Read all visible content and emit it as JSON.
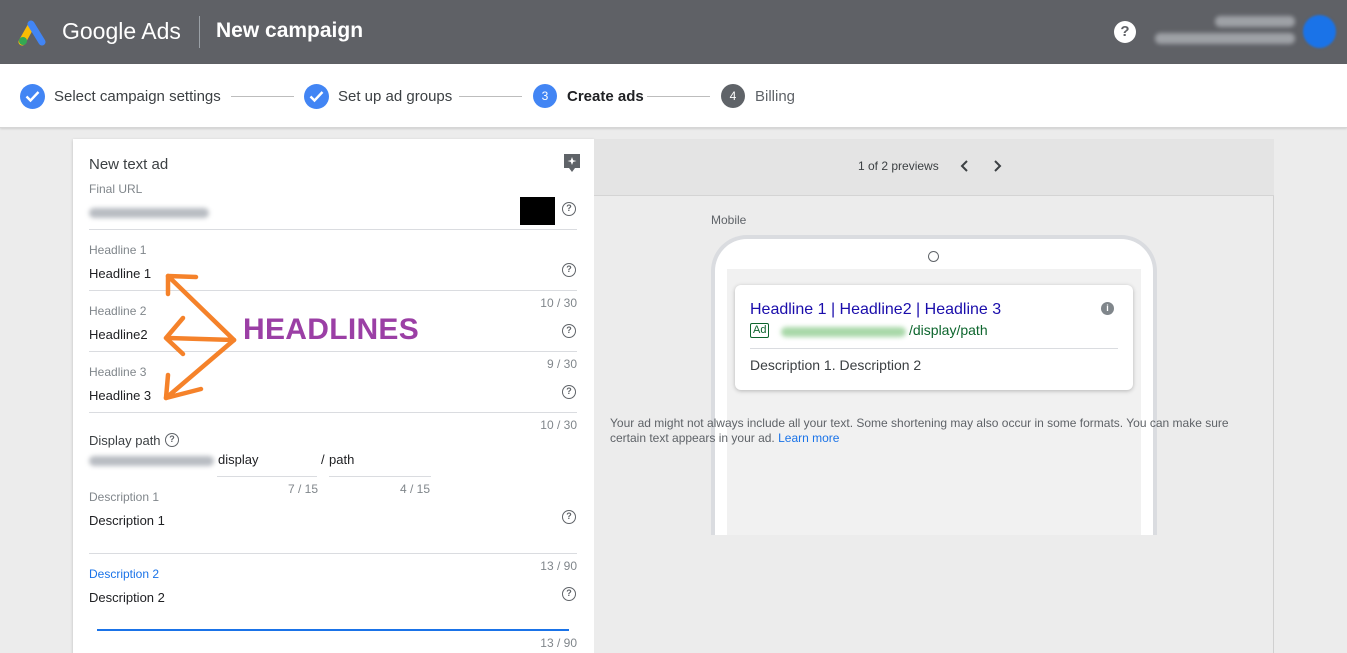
{
  "header": {
    "brand": "Google Ads",
    "page_title": "New campaign",
    "help_icon": "help-circle-icon",
    "help_glyph": "?"
  },
  "stepper": {
    "steps": [
      {
        "number": "",
        "label": "Select campaign settings",
        "state": "done"
      },
      {
        "number": "",
        "label": "Set up ad groups",
        "state": "done"
      },
      {
        "number": "3",
        "label": "Create ads",
        "state": "current"
      },
      {
        "number": "4",
        "label": "Billing",
        "state": "upcoming"
      }
    ]
  },
  "ad_form": {
    "title": "New text ad",
    "final_url": {
      "label": "Final URL"
    },
    "headline1": {
      "label": "Headline 1",
      "value": "Headline 1",
      "counter": "10 / 30"
    },
    "headline2": {
      "label": "Headline 2",
      "value": "Headline2",
      "counter": "9 / 30"
    },
    "headline3": {
      "label": "Headline 3",
      "value": "Headline 3",
      "counter": "10 / 30"
    },
    "display_path": {
      "label": "Display path",
      "path1": "display",
      "separator": "/",
      "path2": "path",
      "path1_counter": "7 / 15",
      "path2_counter": "4 / 15"
    },
    "description1": {
      "label": "Description 1",
      "value": "Description 1",
      "counter": "13 / 90"
    },
    "description2": {
      "label": "Description 2",
      "value": "Description 2",
      "counter": "13 / 90"
    }
  },
  "annotation": {
    "label": "HEADLINES",
    "color": "#9b3fa5",
    "arrow_color": "#f5822a"
  },
  "preview": {
    "count_text": "1 of 2 previews",
    "device_label": "Mobile",
    "ad": {
      "headline": "Headline 1 | Headline2 | Headline 3",
      "badge": "Ad",
      "url_suffix": "/display/path",
      "description": "Description 1. Description 2",
      "info_glyph": "i"
    },
    "note": "Your ad might not always include all your text. Some shortening may also occur in some formats. You can make sure certain text appears in your ad.",
    "learn_more": "Learn more"
  },
  "colors": {
    "topbar": "#5f6166",
    "accent": "#4285f4",
    "link": "#1a73e8",
    "ad_headline": "#1a0dab",
    "ad_url": "#0d652d"
  }
}
